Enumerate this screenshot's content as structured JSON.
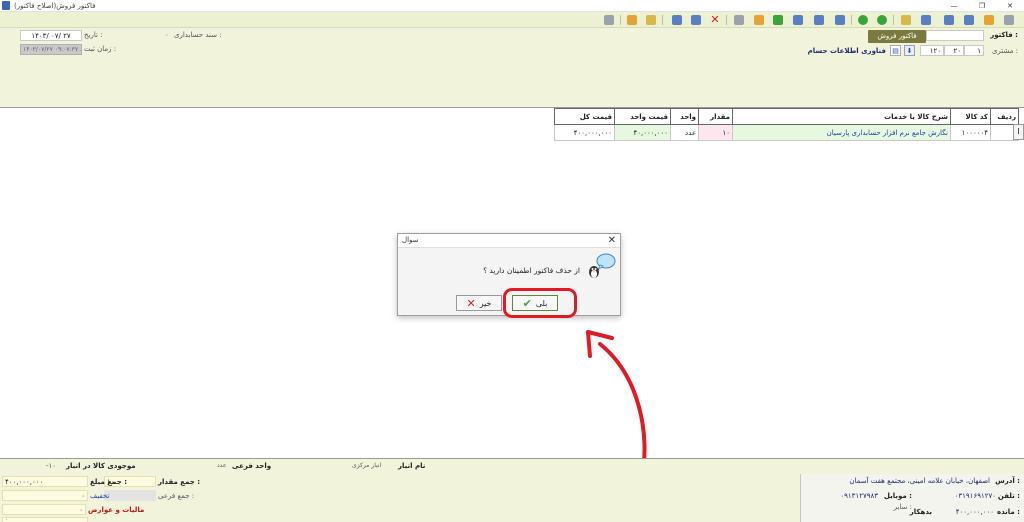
{
  "window": {
    "title": "فاکتور فروش(اصلاح فاکتور)",
    "controls": [
      "—",
      "❐",
      "✕"
    ]
  },
  "header": {
    "invoice_label": "فاکتور :",
    "invoice_type": "فاکتور فروش",
    "customer_label": "مشتری :",
    "customer_code_1": "۱",
    "customer_code_2": "۲۰",
    "customer_code_3": "۱۲۰",
    "customer_name": "فناوری اطلاعات حسام",
    "voucher_label": "سند حسابداری :",
    "voucher_value": "۰",
    "date_label": "تاریخ :",
    "date_value": "۱۴۰۳/ ۰۷/ ۲۷",
    "record_time_label": "زمان ثبت :",
    "record_time_value": "۱۴۰۳/۰۷/۲۷ ۰۹:۰۷:۳۷ ب.ظ"
  },
  "grid": {
    "columns": [
      "ردیف",
      "کد کالا",
      "شرح کالا یا خدمات",
      "مقدار",
      "واحد",
      "قیمت واحد",
      "قیمت کل"
    ],
    "rows": [
      {
        "row": "۱",
        "code": "۱۰۰۰۰۰۴",
        "description": "نگارش جامع نرم افزار حسابداری پارسیان",
        "qty": "۱۰",
        "unit": "عدد",
        "unit_price": "۴۰,۰۰۰,۰۰۰",
        "total": "۴۰۰,۰۰۰,۰۰۰"
      }
    ]
  },
  "dialog": {
    "title": "سوال",
    "message": "از حذف فاکتور اطمینان دارید ؟",
    "yes_label": "بلی",
    "no_label": "خیر"
  },
  "footer": {
    "warehouse_label": "نام انبار",
    "warehouse_value": "انبار مرکزی",
    "subunit_label": "واحد فرعی",
    "subunit_value": "عدد",
    "stock_label": "موجودی کالا در انبار",
    "stock_value": "-۱۰",
    "qty_sum_label": "جمع مقدار :",
    "qty_sum_value": "۱۰",
    "amount_sum_label": "جمع مبلغ :",
    "amount_sum_value": "۴۰۰,۰۰۰,۰۰۰",
    "subunit_sum_label": "جمع فرعی :",
    "discount_label": "تخفیف",
    "discount_value": "۰",
    "tax_label": "مالیات و عوارض",
    "tax_value": "۰",
    "row4_value": "۰",
    "address_label": "آدرس :",
    "address_value": "اصفهان، خیابان علامه امینی، مجتمع هفت آسمان",
    "phone_label": "تلفن :",
    "phone_value": "۰۳۱۹۱۶۹۱۲۷۰",
    "mobile_label": "موبایل :",
    "mobile_value": "۰۹۱۳۱۲۷۹۸۳",
    "balance_label": "مانده :",
    "balance_value": "۴۰۰,۰۰۰,۰۰۰",
    "balance_status": "بدهکار",
    "other_label": "سایر :"
  },
  "colors": {
    "toolbar_bg": "#ecf1d2",
    "panel_bg": "#f1f3db",
    "badge_bg": "#7a7a3c",
    "highlight_red": "#e01b24",
    "link_blue": "#1c3fa5"
  }
}
